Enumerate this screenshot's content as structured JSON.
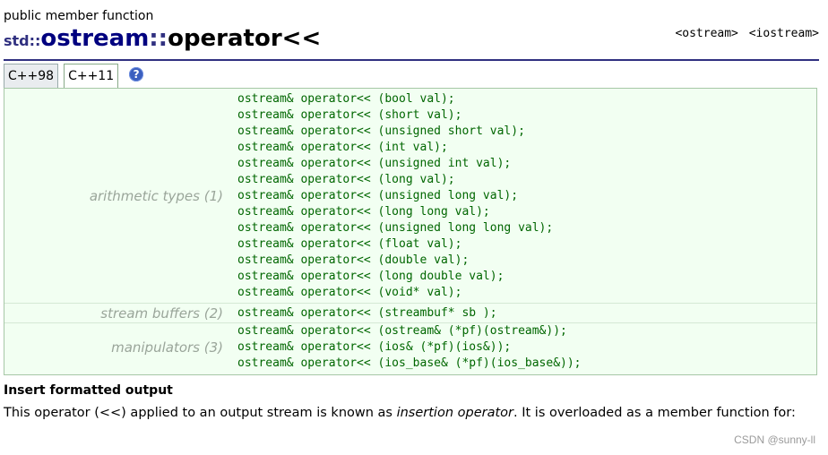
{
  "header": {
    "kind": "public member function",
    "namespace": "std::",
    "class_name": "ostream",
    "separator": "::",
    "function_name": "operator<<",
    "headers": [
      "<ostream>",
      "<iostream>"
    ]
  },
  "tabs": [
    {
      "label": "C++98",
      "active": false
    },
    {
      "label": "C++11",
      "active": true
    }
  ],
  "help_icon": "?",
  "groups": [
    {
      "label": "arithmetic types (1)",
      "decls": [
        "ostream& operator<< (bool val);",
        "ostream& operator<< (short val);",
        "ostream& operator<< (unsigned short val);",
        "ostream& operator<< (int val);",
        "ostream& operator<< (unsigned int val);",
        "ostream& operator<< (long val);",
        "ostream& operator<< (unsigned long val);",
        "ostream& operator<< (long long val);",
        "ostream& operator<< (unsigned long long val);",
        "ostream& operator<< (float val);",
        "ostream& operator<< (double val);",
        "ostream& operator<< (long double val);",
        "ostream& operator<< (void* val);"
      ]
    },
    {
      "label": "stream buffers (2)",
      "decls": [
        "ostream& operator<< (streambuf* sb );"
      ]
    },
    {
      "label": "manipulators (3)",
      "decls": [
        "ostream& operator<< (ostream& (*pf)(ostream&));",
        "ostream& operator<< (ios& (*pf)(ios&));",
        "ostream& operator<< (ios_base& (*pf)(ios_base&));"
      ]
    }
  ],
  "section": {
    "heading": "Insert formatted output",
    "para_before": "This operator (<<) applied to an output stream is known as ",
    "para_em": "insertion operator",
    "para_after": ". It is overloaded as a member function for:"
  },
  "watermark": "CSDN @sunny-ll"
}
